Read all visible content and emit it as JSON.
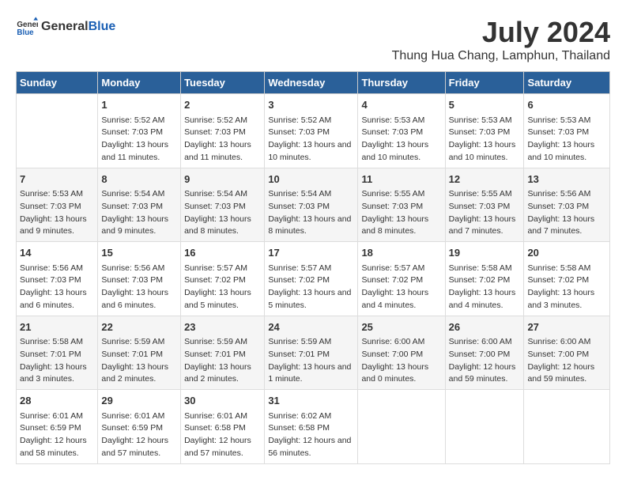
{
  "logo": {
    "general": "General",
    "blue": "Blue"
  },
  "title": "July 2024",
  "subtitle": "Thung Hua Chang, Lamphun, Thailand",
  "days_of_week": [
    "Sunday",
    "Monday",
    "Tuesday",
    "Wednesday",
    "Thursday",
    "Friday",
    "Saturday"
  ],
  "weeks": [
    [
      {
        "day": "",
        "info": ""
      },
      {
        "day": "1",
        "sunrise": "Sunrise: 5:52 AM",
        "sunset": "Sunset: 7:03 PM",
        "daylight": "Daylight: 13 hours and 11 minutes."
      },
      {
        "day": "2",
        "sunrise": "Sunrise: 5:52 AM",
        "sunset": "Sunset: 7:03 PM",
        "daylight": "Daylight: 13 hours and 11 minutes."
      },
      {
        "day": "3",
        "sunrise": "Sunrise: 5:52 AM",
        "sunset": "Sunset: 7:03 PM",
        "daylight": "Daylight: 13 hours and 10 minutes."
      },
      {
        "day": "4",
        "sunrise": "Sunrise: 5:53 AM",
        "sunset": "Sunset: 7:03 PM",
        "daylight": "Daylight: 13 hours and 10 minutes."
      },
      {
        "day": "5",
        "sunrise": "Sunrise: 5:53 AM",
        "sunset": "Sunset: 7:03 PM",
        "daylight": "Daylight: 13 hours and 10 minutes."
      },
      {
        "day": "6",
        "sunrise": "Sunrise: 5:53 AM",
        "sunset": "Sunset: 7:03 PM",
        "daylight": "Daylight: 13 hours and 10 minutes."
      }
    ],
    [
      {
        "day": "7",
        "sunrise": "Sunrise: 5:53 AM",
        "sunset": "Sunset: 7:03 PM",
        "daylight": "Daylight: 13 hours and 9 minutes."
      },
      {
        "day": "8",
        "sunrise": "Sunrise: 5:54 AM",
        "sunset": "Sunset: 7:03 PM",
        "daylight": "Daylight: 13 hours and 9 minutes."
      },
      {
        "day": "9",
        "sunrise": "Sunrise: 5:54 AM",
        "sunset": "Sunset: 7:03 PM",
        "daylight": "Daylight: 13 hours and 8 minutes."
      },
      {
        "day": "10",
        "sunrise": "Sunrise: 5:54 AM",
        "sunset": "Sunset: 7:03 PM",
        "daylight": "Daylight: 13 hours and 8 minutes."
      },
      {
        "day": "11",
        "sunrise": "Sunrise: 5:55 AM",
        "sunset": "Sunset: 7:03 PM",
        "daylight": "Daylight: 13 hours and 8 minutes."
      },
      {
        "day": "12",
        "sunrise": "Sunrise: 5:55 AM",
        "sunset": "Sunset: 7:03 PM",
        "daylight": "Daylight: 13 hours and 7 minutes."
      },
      {
        "day": "13",
        "sunrise": "Sunrise: 5:56 AM",
        "sunset": "Sunset: 7:03 PM",
        "daylight": "Daylight: 13 hours and 7 minutes."
      }
    ],
    [
      {
        "day": "14",
        "sunrise": "Sunrise: 5:56 AM",
        "sunset": "Sunset: 7:03 PM",
        "daylight": "Daylight: 13 hours and 6 minutes."
      },
      {
        "day": "15",
        "sunrise": "Sunrise: 5:56 AM",
        "sunset": "Sunset: 7:03 PM",
        "daylight": "Daylight: 13 hours and 6 minutes."
      },
      {
        "day": "16",
        "sunrise": "Sunrise: 5:57 AM",
        "sunset": "Sunset: 7:02 PM",
        "daylight": "Daylight: 13 hours and 5 minutes."
      },
      {
        "day": "17",
        "sunrise": "Sunrise: 5:57 AM",
        "sunset": "Sunset: 7:02 PM",
        "daylight": "Daylight: 13 hours and 5 minutes."
      },
      {
        "day": "18",
        "sunrise": "Sunrise: 5:57 AM",
        "sunset": "Sunset: 7:02 PM",
        "daylight": "Daylight: 13 hours and 4 minutes."
      },
      {
        "day": "19",
        "sunrise": "Sunrise: 5:58 AM",
        "sunset": "Sunset: 7:02 PM",
        "daylight": "Daylight: 13 hours and 4 minutes."
      },
      {
        "day": "20",
        "sunrise": "Sunrise: 5:58 AM",
        "sunset": "Sunset: 7:02 PM",
        "daylight": "Daylight: 13 hours and 3 minutes."
      }
    ],
    [
      {
        "day": "21",
        "sunrise": "Sunrise: 5:58 AM",
        "sunset": "Sunset: 7:01 PM",
        "daylight": "Daylight: 13 hours and 3 minutes."
      },
      {
        "day": "22",
        "sunrise": "Sunrise: 5:59 AM",
        "sunset": "Sunset: 7:01 PM",
        "daylight": "Daylight: 13 hours and 2 minutes."
      },
      {
        "day": "23",
        "sunrise": "Sunrise: 5:59 AM",
        "sunset": "Sunset: 7:01 PM",
        "daylight": "Daylight: 13 hours and 2 minutes."
      },
      {
        "day": "24",
        "sunrise": "Sunrise: 5:59 AM",
        "sunset": "Sunset: 7:01 PM",
        "daylight": "Daylight: 13 hours and 1 minute."
      },
      {
        "day": "25",
        "sunrise": "Sunrise: 6:00 AM",
        "sunset": "Sunset: 7:00 PM",
        "daylight": "Daylight: 13 hours and 0 minutes."
      },
      {
        "day": "26",
        "sunrise": "Sunrise: 6:00 AM",
        "sunset": "Sunset: 7:00 PM",
        "daylight": "Daylight: 12 hours and 59 minutes."
      },
      {
        "day": "27",
        "sunrise": "Sunrise: 6:00 AM",
        "sunset": "Sunset: 7:00 PM",
        "daylight": "Daylight: 12 hours and 59 minutes."
      }
    ],
    [
      {
        "day": "28",
        "sunrise": "Sunrise: 6:01 AM",
        "sunset": "Sunset: 6:59 PM",
        "daylight": "Daylight: 12 hours and 58 minutes."
      },
      {
        "day": "29",
        "sunrise": "Sunrise: 6:01 AM",
        "sunset": "Sunset: 6:59 PM",
        "daylight": "Daylight: 12 hours and 57 minutes."
      },
      {
        "day": "30",
        "sunrise": "Sunrise: 6:01 AM",
        "sunset": "Sunset: 6:58 PM",
        "daylight": "Daylight: 12 hours and 57 minutes."
      },
      {
        "day": "31",
        "sunrise": "Sunrise: 6:02 AM",
        "sunset": "Sunset: 6:58 PM",
        "daylight": "Daylight: 12 hours and 56 minutes."
      },
      {
        "day": "",
        "info": ""
      },
      {
        "day": "",
        "info": ""
      },
      {
        "day": "",
        "info": ""
      }
    ]
  ]
}
